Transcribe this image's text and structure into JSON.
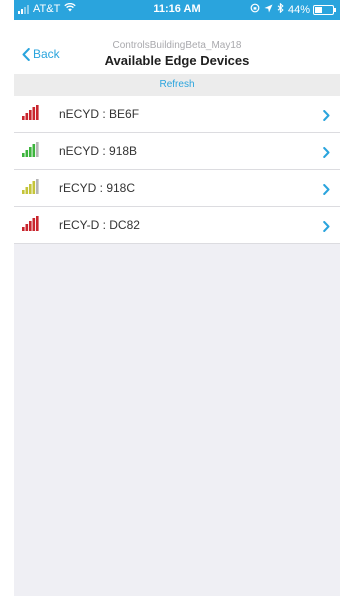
{
  "status_bar": {
    "carrier": "AT&T",
    "time": "11:16 AM",
    "battery_text": "44%",
    "battery_level": 0.44,
    "icons": [
      "cellular-signal-icon",
      "wifi-icon",
      "lock-rotation-icon",
      "location-arrow-icon",
      "bluetooth-icon",
      "battery-icon"
    ]
  },
  "nav": {
    "back_label": "Back",
    "subtitle": "ControlsBuildingBeta_May18",
    "title": "Available Edge Devices"
  },
  "refresh": {
    "label": "Refresh"
  },
  "devices": [
    {
      "label": "nECYD : BE6F",
      "signal_icon": "signal-strength-icon",
      "signal_color": "#c9252d",
      "signal_bars": 5
    },
    {
      "label": "nECYD : 918B",
      "signal_icon": "signal-strength-icon",
      "signal_color": "#3cb43c",
      "signal_bars": 4
    },
    {
      "label": "rECYD : 918C",
      "signal_icon": "signal-strength-icon",
      "signal_color": "#c4c43a",
      "signal_bars": 4
    },
    {
      "label": "rECY-D : DC82",
      "signal_icon": "signal-strength-icon",
      "signal_color": "#c9252d",
      "signal_bars": 5
    }
  ],
  "colors": {
    "accent": "#2aa4dd",
    "background": "#efeff4",
    "chevron": "#2aa4dd",
    "inactive_bar": "#b5b5b5"
  }
}
